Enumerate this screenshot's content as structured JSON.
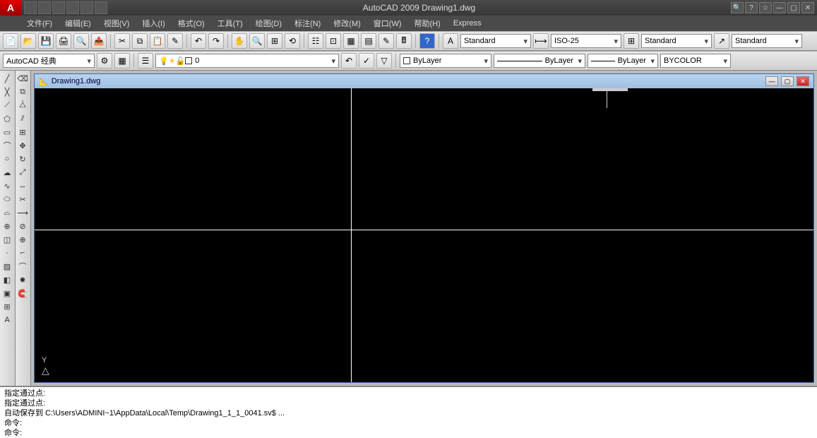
{
  "app": {
    "title": "AutoCAD 2009 Drawing1.dwg",
    "logo_letter": "A"
  },
  "menubar": {
    "items": [
      {
        "label": "文件(F)"
      },
      {
        "label": "编辑(E)"
      },
      {
        "label": "视图(V)"
      },
      {
        "label": "插入(I)"
      },
      {
        "label": "格式(O)"
      },
      {
        "label": "工具(T)"
      },
      {
        "label": "绘图(D)"
      },
      {
        "label": "标注(N)"
      },
      {
        "label": "修改(M)"
      },
      {
        "label": "窗口(W)"
      },
      {
        "label": "帮助(H)"
      },
      {
        "label": "Express"
      }
    ]
  },
  "toolbar1": {
    "styles": {
      "text_style": "Standard",
      "dim_style": "ISO-25",
      "table_style": "Standard",
      "mleader_style": "Standard"
    }
  },
  "toolbar2": {
    "workspace": "AutoCAD 经典",
    "layer": "0",
    "linetype_layer": "ByLayer",
    "lineweight": "ByLayer",
    "linetype": "ByLayer",
    "plot_style": "BYCOLOR"
  },
  "document": {
    "title": "Drawing1.dwg",
    "ucs_y": "Y"
  },
  "command": {
    "lines": [
      "指定通过点:",
      "指定通过点:",
      "自动保存到 C:\\Users\\ADMINI~1\\AppData\\Local\\Temp\\Drawing1_1_1_0041.sv$ ...",
      "命令:",
      "命令:"
    ]
  }
}
